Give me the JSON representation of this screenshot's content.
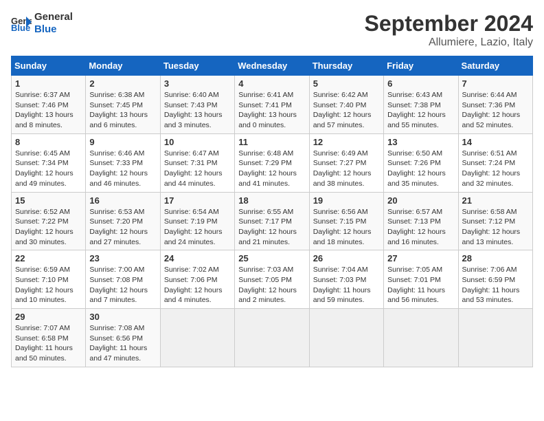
{
  "header": {
    "logo_line1": "General",
    "logo_line2": "Blue",
    "title": "September 2024",
    "subtitle": "Allumiere, Lazio, Italy"
  },
  "weekdays": [
    "Sunday",
    "Monday",
    "Tuesday",
    "Wednesday",
    "Thursday",
    "Friday",
    "Saturday"
  ],
  "weeks": [
    [
      {
        "day": "1",
        "info": "Sunrise: 6:37 AM\nSunset: 7:46 PM\nDaylight: 13 hours\nand 8 minutes."
      },
      {
        "day": "2",
        "info": "Sunrise: 6:38 AM\nSunset: 7:45 PM\nDaylight: 13 hours\nand 6 minutes."
      },
      {
        "day": "3",
        "info": "Sunrise: 6:40 AM\nSunset: 7:43 PM\nDaylight: 13 hours\nand 3 minutes."
      },
      {
        "day": "4",
        "info": "Sunrise: 6:41 AM\nSunset: 7:41 PM\nDaylight: 13 hours\nand 0 minutes."
      },
      {
        "day": "5",
        "info": "Sunrise: 6:42 AM\nSunset: 7:40 PM\nDaylight: 12 hours\nand 57 minutes."
      },
      {
        "day": "6",
        "info": "Sunrise: 6:43 AM\nSunset: 7:38 PM\nDaylight: 12 hours\nand 55 minutes."
      },
      {
        "day": "7",
        "info": "Sunrise: 6:44 AM\nSunset: 7:36 PM\nDaylight: 12 hours\nand 52 minutes."
      }
    ],
    [
      {
        "day": "8",
        "info": "Sunrise: 6:45 AM\nSunset: 7:34 PM\nDaylight: 12 hours\nand 49 minutes."
      },
      {
        "day": "9",
        "info": "Sunrise: 6:46 AM\nSunset: 7:33 PM\nDaylight: 12 hours\nand 46 minutes."
      },
      {
        "day": "10",
        "info": "Sunrise: 6:47 AM\nSunset: 7:31 PM\nDaylight: 12 hours\nand 44 minutes."
      },
      {
        "day": "11",
        "info": "Sunrise: 6:48 AM\nSunset: 7:29 PM\nDaylight: 12 hours\nand 41 minutes."
      },
      {
        "day": "12",
        "info": "Sunrise: 6:49 AM\nSunset: 7:27 PM\nDaylight: 12 hours\nand 38 minutes."
      },
      {
        "day": "13",
        "info": "Sunrise: 6:50 AM\nSunset: 7:26 PM\nDaylight: 12 hours\nand 35 minutes."
      },
      {
        "day": "14",
        "info": "Sunrise: 6:51 AM\nSunset: 7:24 PM\nDaylight: 12 hours\nand 32 minutes."
      }
    ],
    [
      {
        "day": "15",
        "info": "Sunrise: 6:52 AM\nSunset: 7:22 PM\nDaylight: 12 hours\nand 30 minutes."
      },
      {
        "day": "16",
        "info": "Sunrise: 6:53 AM\nSunset: 7:20 PM\nDaylight: 12 hours\nand 27 minutes."
      },
      {
        "day": "17",
        "info": "Sunrise: 6:54 AM\nSunset: 7:19 PM\nDaylight: 12 hours\nand 24 minutes."
      },
      {
        "day": "18",
        "info": "Sunrise: 6:55 AM\nSunset: 7:17 PM\nDaylight: 12 hours\nand 21 minutes."
      },
      {
        "day": "19",
        "info": "Sunrise: 6:56 AM\nSunset: 7:15 PM\nDaylight: 12 hours\nand 18 minutes."
      },
      {
        "day": "20",
        "info": "Sunrise: 6:57 AM\nSunset: 7:13 PM\nDaylight: 12 hours\nand 16 minutes."
      },
      {
        "day": "21",
        "info": "Sunrise: 6:58 AM\nSunset: 7:12 PM\nDaylight: 12 hours\nand 13 minutes."
      }
    ],
    [
      {
        "day": "22",
        "info": "Sunrise: 6:59 AM\nSunset: 7:10 PM\nDaylight: 12 hours\nand 10 minutes."
      },
      {
        "day": "23",
        "info": "Sunrise: 7:00 AM\nSunset: 7:08 PM\nDaylight: 12 hours\nand 7 minutes."
      },
      {
        "day": "24",
        "info": "Sunrise: 7:02 AM\nSunset: 7:06 PM\nDaylight: 12 hours\nand 4 minutes."
      },
      {
        "day": "25",
        "info": "Sunrise: 7:03 AM\nSunset: 7:05 PM\nDaylight: 12 hours\nand 2 minutes."
      },
      {
        "day": "26",
        "info": "Sunrise: 7:04 AM\nSunset: 7:03 PM\nDaylight: 11 hours\nand 59 minutes."
      },
      {
        "day": "27",
        "info": "Sunrise: 7:05 AM\nSunset: 7:01 PM\nDaylight: 11 hours\nand 56 minutes."
      },
      {
        "day": "28",
        "info": "Sunrise: 7:06 AM\nSunset: 6:59 PM\nDaylight: 11 hours\nand 53 minutes."
      }
    ],
    [
      {
        "day": "29",
        "info": "Sunrise: 7:07 AM\nSunset: 6:58 PM\nDaylight: 11 hours\nand 50 minutes."
      },
      {
        "day": "30",
        "info": "Sunrise: 7:08 AM\nSunset: 6:56 PM\nDaylight: 11 hours\nand 47 minutes."
      },
      {
        "day": "",
        "info": ""
      },
      {
        "day": "",
        "info": ""
      },
      {
        "day": "",
        "info": ""
      },
      {
        "day": "",
        "info": ""
      },
      {
        "day": "",
        "info": ""
      }
    ]
  ]
}
